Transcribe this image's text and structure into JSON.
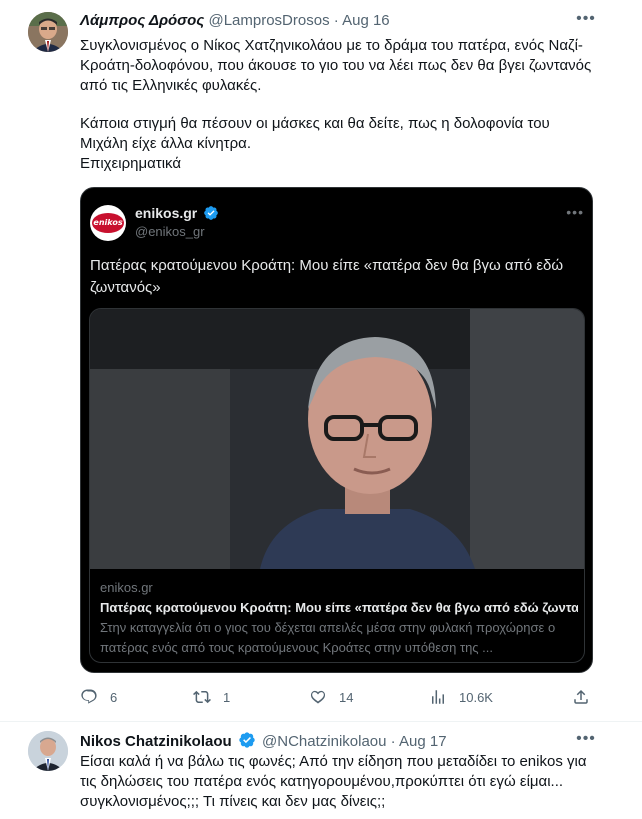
{
  "tweet1": {
    "author_name": "Λάμπρος Δρόσος",
    "handle": "@LamprosDrosos",
    "separator": "·",
    "date": "Aug 16",
    "text_p1": "Συγκλονισμένος ο Νίκος Χατζηνικολάου με το δράμα του πατέρα, ενός Ναζί-Κροάτη-δολοφόνου, που άκουσε το γιο του να λέει πως δεν θα βγει ζωντανός από τις Ελληνικές φυλακές.",
    "text_p2": "Κάποια στιγμή θα πέσουν οι μάσκες και θα δείτε, πως η δολοφονία του Μιχάλη είχε άλλα κίνητρα.\nΕπιχειρηματικά",
    "more_icon": "more-horizontal-icon",
    "quote": {
      "logo_text": "enikos",
      "name": "enikos.gr",
      "handle": "@enikos_gr",
      "text": "Πατέρας κρατούμενου Κροάτη: Μου είπε «πατέρα δεν θα βγω από εδώ ζωντανός»",
      "link_domain": "enikos.gr",
      "link_title": "Πατέρας κρατούμενου Κροάτη: Μου είπε «πατέρα δεν θα βγω από εδώ ζωντα...",
      "link_desc": "Στην καταγγελία ότι ο γιος του δέχεται απειλές μέσα στην φυλακή προχώρησε ο πατέρας ενός από τους κρατούμενους Κροάτες στην υπόθεση της ..."
    },
    "actions": {
      "replies": "6",
      "retweets": "1",
      "likes": "14",
      "views": "10.6K"
    }
  },
  "tweet2": {
    "author_name": "Nikos Chatzinikolaou",
    "handle": "@NChatzinikolaou",
    "separator": "·",
    "date": "Aug 17",
    "text": "Είσαι καλά ή να βάλω τις φωνές; Από την είδηση που μεταδίδει το enikos για τις δηλώσεις του πατέρα ενός κατηγορουμένου,προκύπτει ότι εγώ είμαι... συγκλονισμένος;;; Τι πίνεις και δεν μας δίνεις;;"
  },
  "colors": {
    "verified": "#1d9bf0",
    "muted": "#536471",
    "card_bg": "#000000"
  }
}
